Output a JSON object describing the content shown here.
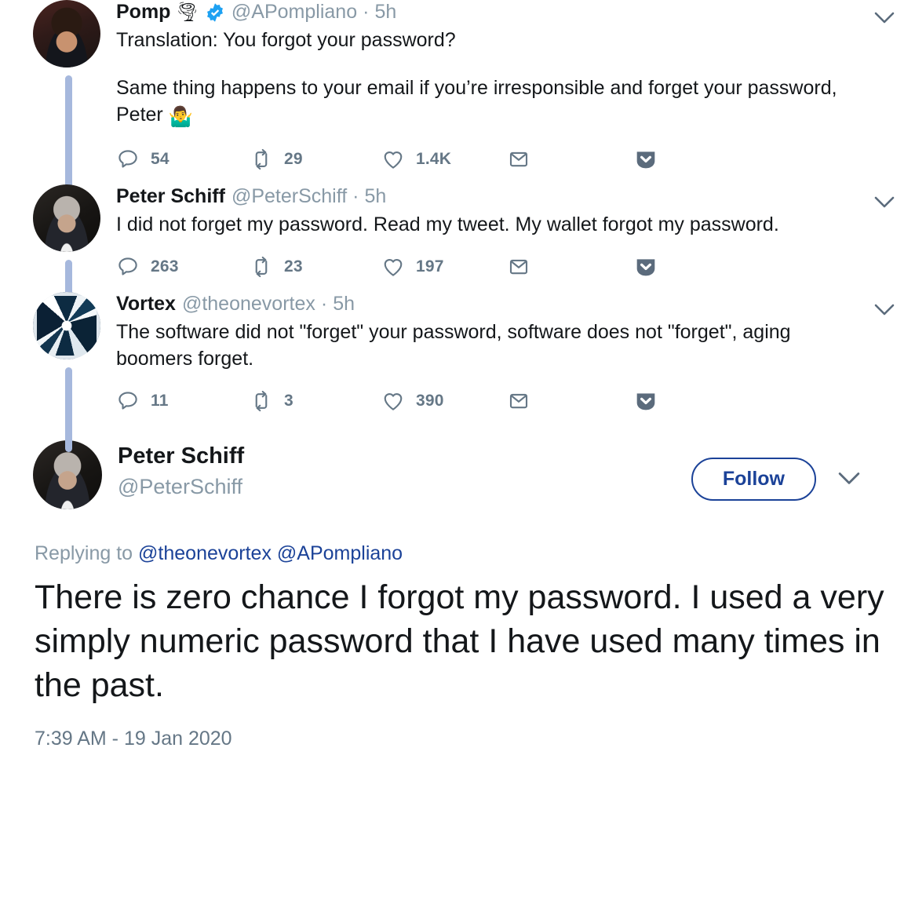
{
  "thread": {
    "connector_color": "#a6b8dd",
    "replies": [
      {
        "author": "Pomp",
        "author_emoji": "🌪",
        "verified": true,
        "handle": "@APompliano",
        "separator": "·",
        "age": "5h",
        "text_lines": [
          "Translation: You forgot your password?",
          "Same thing happens to your email if you’re irresponsible and forget your password, Peter "
        ],
        "text_emoji": "🤷‍♂️",
        "avatar": "pomp-avatar",
        "actions": {
          "reply_count": "54",
          "retweet_count": "29",
          "like_count": "1.4K",
          "dm_label": "",
          "badge_label": ""
        }
      },
      {
        "author": "Peter Schiff",
        "author_emoji": "",
        "verified": false,
        "handle": "@PeterSchiff",
        "separator": "·",
        "age": "5h",
        "text_lines": [
          "I did not forget my password.  Read my tweet.  My wallet forgot my password."
        ],
        "text_emoji": "",
        "avatar": "peter-schiff-avatar",
        "actions": {
          "reply_count": "263",
          "retweet_count": "23",
          "like_count": "197",
          "dm_label": "",
          "badge_label": ""
        }
      },
      {
        "author": "Vortex",
        "author_emoji": "",
        "verified": false,
        "handle": "@theonevortex",
        "separator": "·",
        "age": "5h",
        "text_lines": [
          "The software did not \"forget\" your password, software does not \"forget\", aging boomers forget."
        ],
        "text_emoji": "",
        "avatar": "vortex-avatar",
        "actions": {
          "reply_count": "11",
          "retweet_count": "3",
          "like_count": "390",
          "dm_label": "",
          "badge_label": ""
        }
      }
    ]
  },
  "main_tweet": {
    "author": "Peter Schiff",
    "handle": "@PeterSchiff",
    "follow_label": "Follow",
    "replying_prefix": "Replying to ",
    "replying_to": [
      "@theonevortex",
      "@APompliano"
    ],
    "text": "There is zero chance I forgot my password.  I used a very simply numeric password that I have used many times in the past.",
    "timestamp": "7:39 AM - 19 Jan 2020"
  },
  "icons": {
    "reply": "reply-icon",
    "retweet": "retweet-icon",
    "like": "like-heart-icon",
    "dm": "direct-message-envelope-icon",
    "badge": "pocket-save-badge-icon",
    "caret": "chevron-down-icon",
    "verified": "verified-badge-icon"
  },
  "colors": {
    "accent_blue": "#1b4298",
    "verified_blue": "#1da1f2",
    "muted": "#8899a6",
    "icon_gray": "#657786",
    "text": "#14171a"
  }
}
